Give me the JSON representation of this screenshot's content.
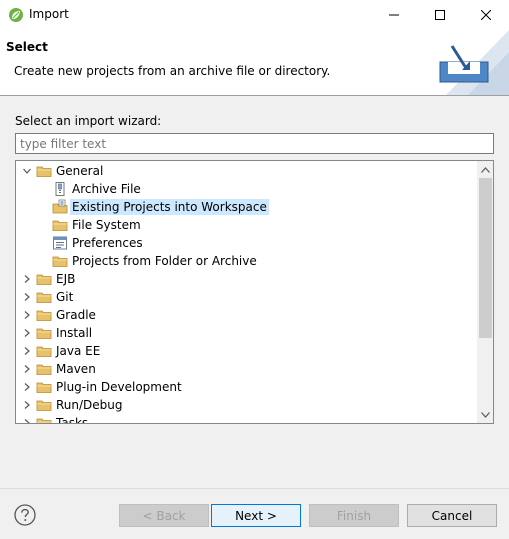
{
  "window": {
    "title": "Import"
  },
  "header": {
    "title": "Select",
    "description": "Create new projects from an archive file or directory."
  },
  "wizard": {
    "label": "Select an import wizard:",
    "filter_placeholder": "type filter text",
    "filter_value": ""
  },
  "tree": {
    "items": [
      {
        "label": "General",
        "level": 0,
        "expanded": true,
        "icon": "folder-icon"
      },
      {
        "label": "Archive File",
        "level": 1,
        "icon": "archive-file-icon"
      },
      {
        "label": "Existing Projects into Workspace",
        "level": 1,
        "icon": "existing-projects-icon",
        "selected": true
      },
      {
        "label": "File System",
        "level": 1,
        "icon": "folder-icon"
      },
      {
        "label": "Preferences",
        "level": 1,
        "icon": "preferences-icon"
      },
      {
        "label": "Projects from Folder or Archive",
        "level": 1,
        "icon": "folder-icon"
      },
      {
        "label": "EJB",
        "level": 0,
        "expanded": false,
        "icon": "folder-icon"
      },
      {
        "label": "Git",
        "level": 0,
        "expanded": false,
        "icon": "folder-icon"
      },
      {
        "label": "Gradle",
        "level": 0,
        "expanded": false,
        "icon": "folder-icon"
      },
      {
        "label": "Install",
        "level": 0,
        "expanded": false,
        "icon": "folder-icon"
      },
      {
        "label": "Java EE",
        "level": 0,
        "expanded": false,
        "icon": "folder-icon"
      },
      {
        "label": "Maven",
        "level": 0,
        "expanded": false,
        "icon": "folder-icon"
      },
      {
        "label": "Plug-in Development",
        "level": 0,
        "expanded": false,
        "icon": "folder-icon"
      },
      {
        "label": "Run/Debug",
        "level": 0,
        "expanded": false,
        "icon": "folder-icon"
      },
      {
        "label": "Tasks",
        "level": 0,
        "expanded": false,
        "icon": "folder-icon"
      }
    ]
  },
  "buttons": {
    "back": "< Back",
    "next": "Next >",
    "finish": "Finish",
    "cancel": "Cancel"
  },
  "colors": {
    "selection": "#cce8ff",
    "folder": "#e8c26b",
    "accent": "#0078d7"
  }
}
